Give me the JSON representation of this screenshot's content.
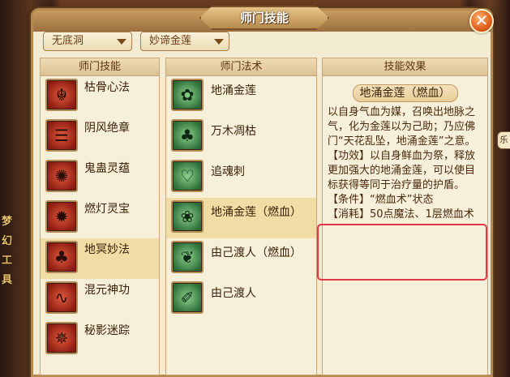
{
  "window": {
    "title": "师门技能"
  },
  "dropdowns": [
    {
      "value": "无底洞"
    },
    {
      "value": "妙谛金莲"
    }
  ],
  "panels": {
    "school_skills": {
      "header": "师门技能",
      "items": [
        {
          "label": "枯骨心法",
          "icon": "skeleton-meditation-icon",
          "glyph": "☬"
        },
        {
          "label": "阴风绝章",
          "icon": "dark-wind-scroll-icon",
          "glyph": "☰"
        },
        {
          "label": "鬼蛊灵蕴",
          "icon": "ghost-gu-icon",
          "glyph": "✺"
        },
        {
          "label": "燃灯灵宝",
          "icon": "lamp-treasure-icon",
          "glyph": "✹"
        },
        {
          "label": "地冥妙法",
          "icon": "underworld-art-icon",
          "glyph": "♣",
          "selected": true
        },
        {
          "label": "混元神功",
          "icon": "chaos-spirit-icon",
          "glyph": "∿"
        },
        {
          "label": "秘影迷踪",
          "icon": "shadow-trace-icon",
          "glyph": "✵"
        }
      ]
    },
    "spells": {
      "header": "师门法术",
      "items": [
        {
          "label": "地涌金莲",
          "icon": "golden-lotus-icon",
          "glyph": "✿"
        },
        {
          "label": "万木凋枯",
          "icon": "withered-tree-icon",
          "glyph": "♣"
        },
        {
          "label": "追魂刺",
          "icon": "soul-thorn-icon",
          "glyph": "♡"
        },
        {
          "label": "地涌金莲（燃血）",
          "icon": "blood-lotus-icon",
          "glyph": "❀",
          "selected": true
        },
        {
          "label": "由己渡人（燃血）",
          "icon": "leaf-transfer-icon",
          "glyph": "❦"
        },
        {
          "label": "由己渡人",
          "icon": "leaf-dagger-icon",
          "glyph": "✐"
        }
      ]
    },
    "effect": {
      "header": "技能效果",
      "name": "地涌金莲（燃血）",
      "description": "以自身气血为媒，召唤出地脉之气，化为金莲以为己助；乃应佛门“天花乱坠，地涌金莲”之意。\n【功效】以自身鲜血为祭，释放更加强大的地涌金莲，可以使目标获得等同于治疗量的护盾。\n【条件】“燃血术”状态\n【消耗】50点魔法、1层燃血术"
    }
  },
  "background": {
    "left_text": "梦幻工具",
    "right_tag": "乐"
  },
  "colors": {
    "dialog_bg": "#f4ecd2",
    "selected_row": "#f0dda6",
    "highlight_border": "#e0364a",
    "close_button": "#e0601c"
  }
}
